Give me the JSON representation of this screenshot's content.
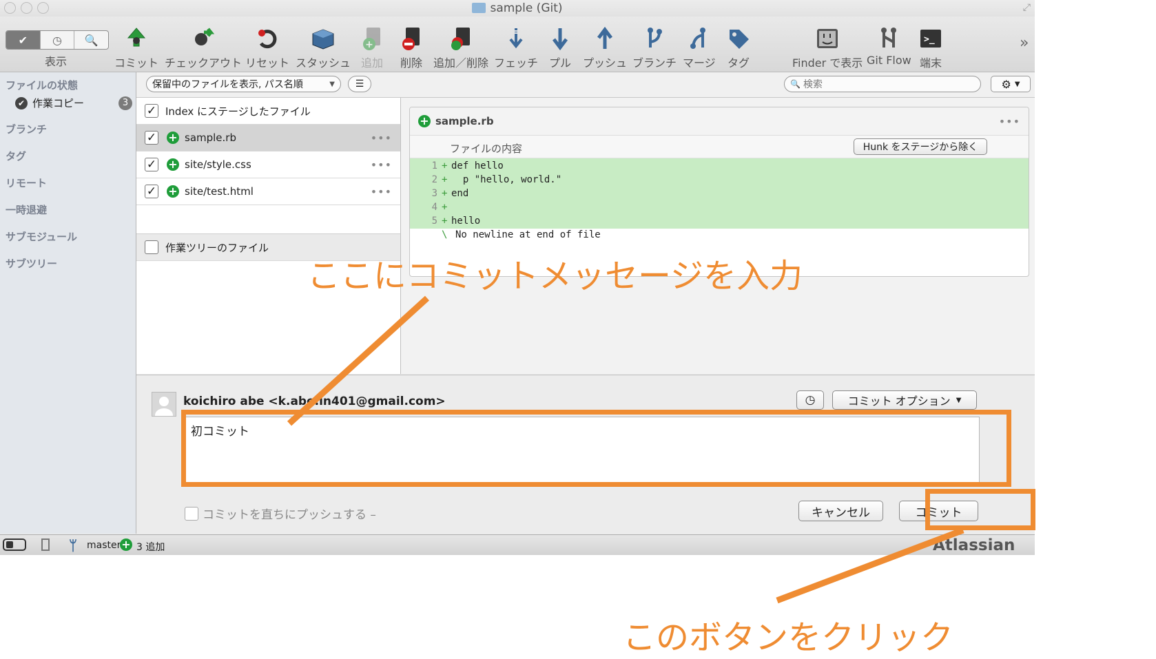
{
  "window": {
    "title": "sample (Git)"
  },
  "toolbar": {
    "view_label": "表示",
    "buttons": [
      {
        "label": "コミット",
        "icon": "commit-icon"
      },
      {
        "label": "チェックアウト",
        "icon": "checkout-icon"
      },
      {
        "label": "リセット",
        "icon": "reset-icon"
      },
      {
        "label": "スタッシュ",
        "icon": "stash-icon"
      },
      {
        "label": "追加",
        "icon": "add-icon"
      },
      {
        "label": "削除",
        "icon": "remove-icon"
      },
      {
        "label": "追加／削除",
        "icon": "add-remove-icon"
      },
      {
        "label": "フェッチ",
        "icon": "fetch-icon"
      },
      {
        "label": "プル",
        "icon": "pull-icon"
      },
      {
        "label": "プッシュ",
        "icon": "push-icon"
      },
      {
        "label": "ブランチ",
        "icon": "branch-icon"
      },
      {
        "label": "マージ",
        "icon": "merge-icon"
      },
      {
        "label": "タグ",
        "icon": "tag-icon"
      },
      {
        "label": "Finder で表示",
        "icon": "finder-icon"
      },
      {
        "label": "Git Flow",
        "icon": "git-flow-icon"
      },
      {
        "label": "端末",
        "icon": "terminal-icon"
      }
    ]
  },
  "sidebar": {
    "file_status": "ファイルの状態",
    "working_copy": "作業コピー",
    "working_copy_count": "3",
    "branches": "ブランチ",
    "tags": "タグ",
    "remotes": "リモート",
    "stashes": "一時退避",
    "submodules": "サブモジュール",
    "subtrees": "サブツリー"
  },
  "filter": {
    "selected": "保留中のファイルを表示, パス名順",
    "search_placeholder": "検索"
  },
  "staged": {
    "header": "Index にステージしたファイル",
    "files": [
      "sample.rb",
      "site/style.css",
      "site/test.html"
    ]
  },
  "unstaged": {
    "header": "作業ツリーのファイル"
  },
  "diff": {
    "file_name": "sample.rb",
    "section": "ファイルの内容",
    "hunk_button": "Hunk をステージから除く",
    "lines": [
      {
        "num": "1",
        "mark": "+",
        "text": "def hello"
      },
      {
        "num": "2",
        "mark": "+",
        "text": "  p \"hello, world.\""
      },
      {
        "num": "3",
        "mark": "+",
        "text": "end"
      },
      {
        "num": "4",
        "mark": "+",
        "text": ""
      },
      {
        "num": "5",
        "mark": "+",
        "text": "hello"
      }
    ],
    "no_newline_mark": "\\",
    "no_newline": "No newline at end of file"
  },
  "commit": {
    "author": "koichiro abe <k.abe.in401@gmail.com>",
    "message": "初コミット",
    "options_label": "コミット オプション",
    "push_label": "コミットを直ちにプッシュする –",
    "cancel_label": "キャンセル",
    "commit_label": "コミット"
  },
  "status": {
    "branch": "master",
    "added": "3 追加",
    "brand": "Atlassian"
  },
  "annotations": {
    "enter_message": "ここにコミットメッセージを入力",
    "click_button": "このボタンをクリック",
    "color": "#ef8c32"
  }
}
